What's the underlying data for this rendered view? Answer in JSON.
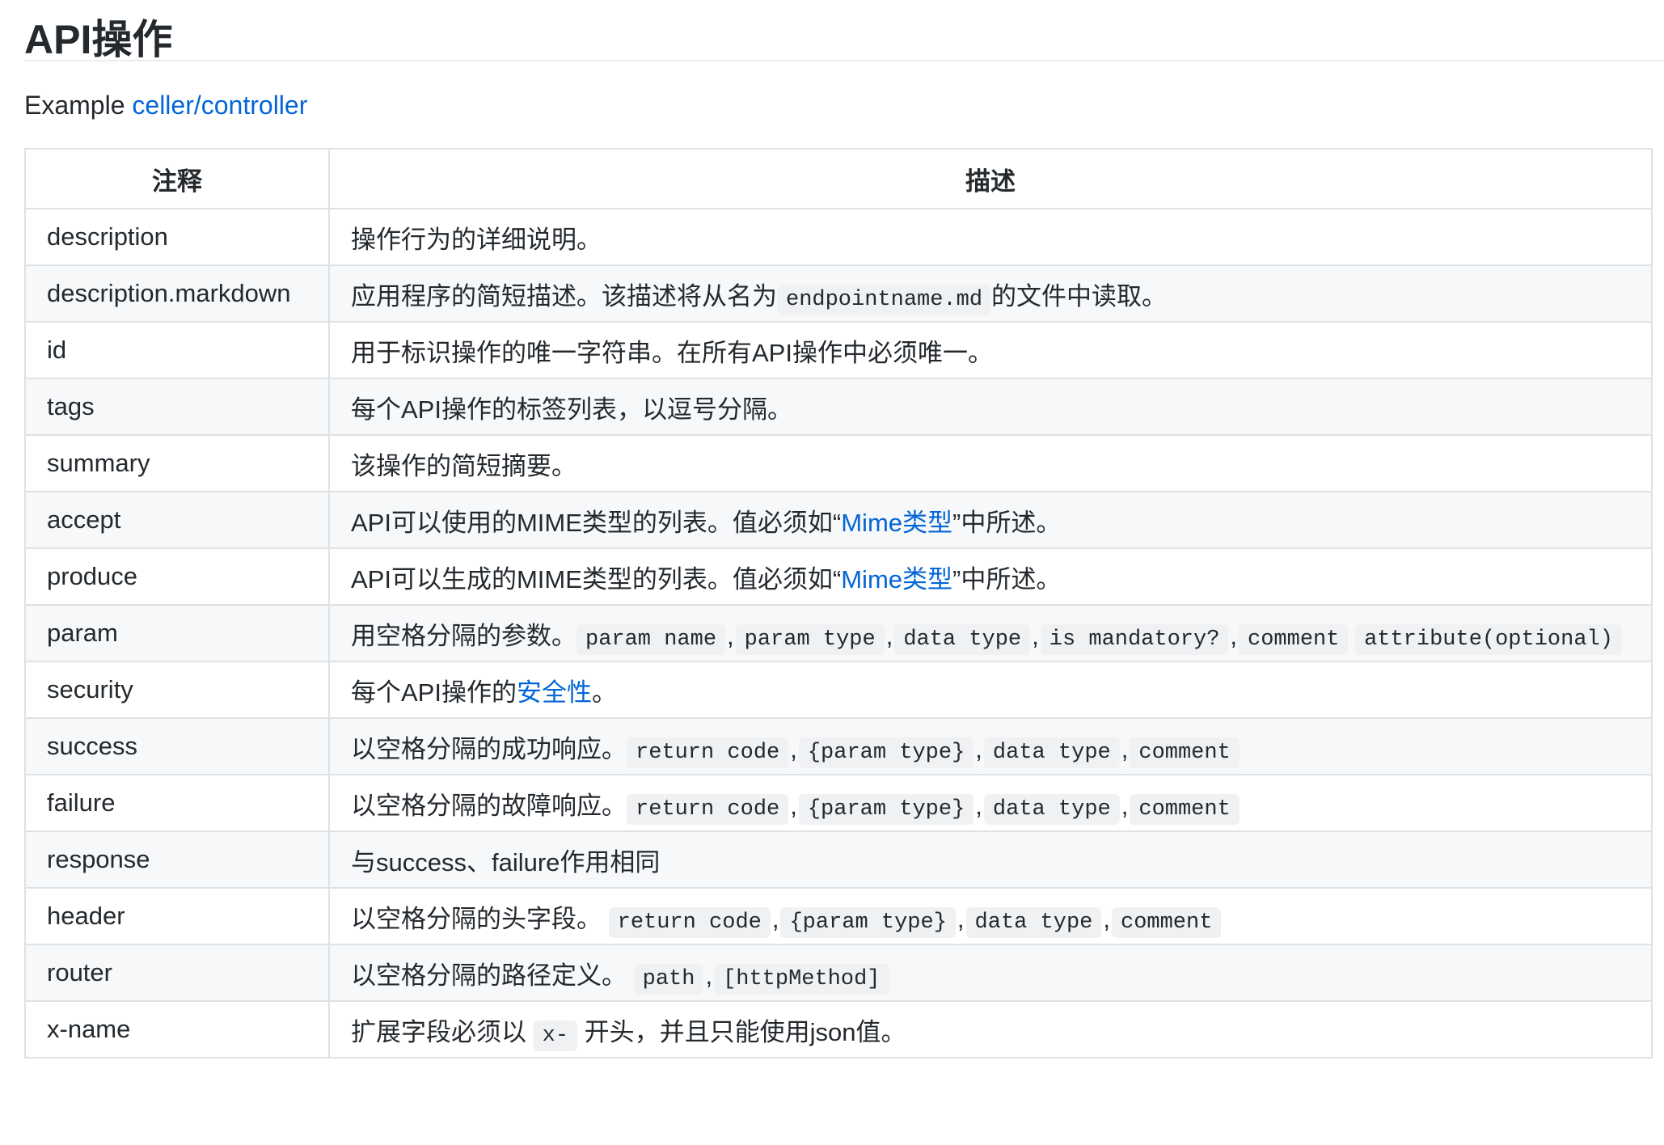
{
  "page": {
    "title": "API操作",
    "intro_prefix": "Example ",
    "intro_link": "celler/controller"
  },
  "table": {
    "headers": [
      "注释",
      "描述"
    ],
    "rows": [
      {
        "key": "description",
        "parts": [
          {
            "t": "text",
            "v": "操作行为的详细说明。"
          }
        ]
      },
      {
        "key": "description.markdown",
        "parts": [
          {
            "t": "text",
            "v": "应用程序的简短描述。该描述将从名为"
          },
          {
            "t": "code",
            "v": "endpointname.md"
          },
          {
            "t": "text",
            "v": "的文件中读取。"
          }
        ]
      },
      {
        "key": "id",
        "parts": [
          {
            "t": "text",
            "v": "用于标识操作的唯一字符串。在所有API操作中必须唯一。"
          }
        ]
      },
      {
        "key": "tags",
        "parts": [
          {
            "t": "text",
            "v": "每个API操作的标签列表，以逗号分隔。"
          }
        ]
      },
      {
        "key": "summary",
        "parts": [
          {
            "t": "text",
            "v": "该操作的简短摘要。"
          }
        ]
      },
      {
        "key": "accept",
        "parts": [
          {
            "t": "text",
            "v": "API可以使用的MIME类型的列表。值必须如“"
          },
          {
            "t": "link",
            "v": "Mime类型"
          },
          {
            "t": "text",
            "v": "”中所述。"
          }
        ]
      },
      {
        "key": "produce",
        "parts": [
          {
            "t": "text",
            "v": "API可以生成的MIME类型的列表。值必须如“"
          },
          {
            "t": "link",
            "v": "Mime类型"
          },
          {
            "t": "text",
            "v": "”中所述。"
          }
        ]
      },
      {
        "key": "param",
        "parts": [
          {
            "t": "text",
            "v": "用空格分隔的参数。"
          },
          {
            "t": "code",
            "v": "param name"
          },
          {
            "t": "sep",
            "v": ","
          },
          {
            "t": "code",
            "v": "param type"
          },
          {
            "t": "sep",
            "v": ","
          },
          {
            "t": "code",
            "v": "data type"
          },
          {
            "t": "sep",
            "v": ","
          },
          {
            "t": "code",
            "v": "is mandatory?"
          },
          {
            "t": "sep",
            "v": ","
          },
          {
            "t": "code",
            "v": "comment"
          },
          {
            "t": "text",
            "v": " "
          },
          {
            "t": "code",
            "v": "attribute(optional)"
          }
        ]
      },
      {
        "key": "security",
        "parts": [
          {
            "t": "text",
            "v": "每个API操作的"
          },
          {
            "t": "link",
            "v": "安全性"
          },
          {
            "t": "text",
            "v": "。"
          }
        ]
      },
      {
        "key": "success",
        "parts": [
          {
            "t": "text",
            "v": "以空格分隔的成功响应。"
          },
          {
            "t": "code",
            "v": "return code"
          },
          {
            "t": "sep",
            "v": ","
          },
          {
            "t": "code",
            "v": "{param type}"
          },
          {
            "t": "sep",
            "v": ","
          },
          {
            "t": "code",
            "v": "data type"
          },
          {
            "t": "sep",
            "v": ","
          },
          {
            "t": "code",
            "v": "comment"
          }
        ]
      },
      {
        "key": "failure",
        "parts": [
          {
            "t": "text",
            "v": "以空格分隔的故障响应。"
          },
          {
            "t": "code",
            "v": "return code"
          },
          {
            "t": "sep",
            "v": ","
          },
          {
            "t": "code",
            "v": "{param type}"
          },
          {
            "t": "sep",
            "v": ","
          },
          {
            "t": "code",
            "v": "data type"
          },
          {
            "t": "sep",
            "v": ","
          },
          {
            "t": "code",
            "v": "comment"
          }
        ]
      },
      {
        "key": "response",
        "parts": [
          {
            "t": "text",
            "v": "与success、failure作用相同"
          }
        ]
      },
      {
        "key": "header",
        "parts": [
          {
            "t": "text",
            "v": "以空格分隔的头字段。 "
          },
          {
            "t": "code",
            "v": "return code"
          },
          {
            "t": "sep",
            "v": ","
          },
          {
            "t": "code",
            "v": "{param type}"
          },
          {
            "t": "sep",
            "v": ","
          },
          {
            "t": "code",
            "v": "data type"
          },
          {
            "t": "sep",
            "v": ","
          },
          {
            "t": "code",
            "v": "comment"
          }
        ]
      },
      {
        "key": "router",
        "parts": [
          {
            "t": "text",
            "v": "以空格分隔的路径定义。 "
          },
          {
            "t": "code",
            "v": "path"
          },
          {
            "t": "sep",
            "v": ","
          },
          {
            "t": "code",
            "v": "[httpMethod]"
          }
        ]
      },
      {
        "key": "x-name",
        "parts": [
          {
            "t": "text",
            "v": "扩展字段必须以 "
          },
          {
            "t": "code",
            "v": "x-"
          },
          {
            "t": "text",
            "v": " 开头，并且只能使用json值。"
          }
        ]
      }
    ]
  }
}
